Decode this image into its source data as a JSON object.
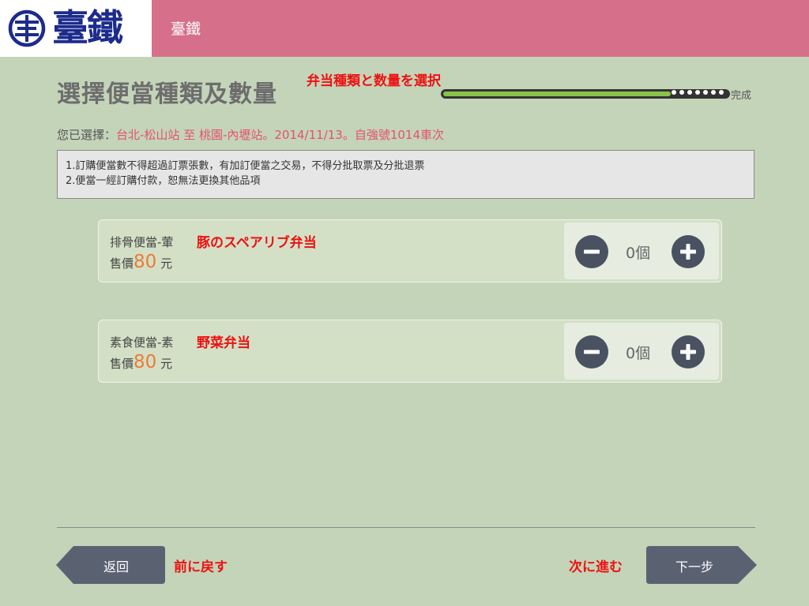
{
  "header": {
    "logo_text": "臺鐵",
    "title": "臺鐵"
  },
  "page": {
    "title": "選擇便當種類及數量",
    "title_annotation": "弁当種類と数量を選択",
    "progress_label": "完成",
    "progress_fraction": 0.8
  },
  "selection": {
    "label": "您已選擇：",
    "value": "台北-松山站 至 桃園-內壢站。2014/11/13。自強號1014車次"
  },
  "notice": {
    "line1": "1.訂購便當數不得超過訂票張數，有加訂便當之交易，不得分批取票及分批退票",
    "line2": "2.便當一經訂購付款，恕無法更換其他品項"
  },
  "products": [
    {
      "name": "排骨便當-葷",
      "annotation": "豚のスペアリブ弁当",
      "price_label": "售價",
      "price": "80",
      "currency": "元",
      "quantity": "0個"
    },
    {
      "name": "素食便當-素",
      "annotation": "野菜弁当",
      "price_label": "售價",
      "price": "80",
      "currency": "元",
      "quantity": "0個"
    }
  ],
  "footer": {
    "back_label": "返回",
    "back_annotation": "前に戻す",
    "next_label": "下一步",
    "next_annotation": "次に進む"
  },
  "colors": {
    "background": "#c4d4b9",
    "header": "#d6708a",
    "logo": "#1c2b8c",
    "annotation": "#ee1111",
    "price": "#e97b38",
    "selection": "#e3536a",
    "button": "#4a5160"
  }
}
